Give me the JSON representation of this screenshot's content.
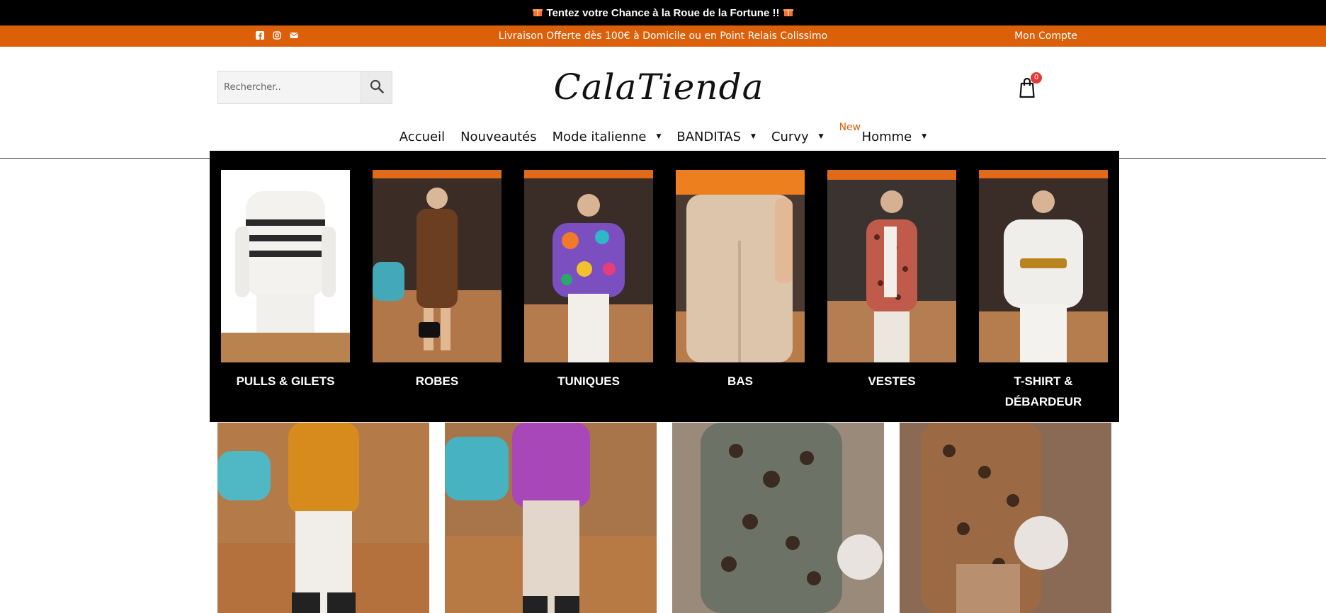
{
  "promo": {
    "text": "Tentez votre Chance à la Roue de la Fortune !!",
    "gift_icon": "gift-icon"
  },
  "infobar": {
    "shipping": "Livraison Offerte dès 100€ à Domicile ou en Point Relais Colissimo",
    "account": "Mon Compte",
    "socials": [
      "facebook-icon",
      "instagram-icon",
      "mail-icon"
    ],
    "accent": "#dc5f0a"
  },
  "search": {
    "placeholder": "Rechercher.."
  },
  "logo": {
    "text": "CalaTienda"
  },
  "cart": {
    "count": "0"
  },
  "nav": {
    "items": [
      {
        "label": "Accueil",
        "has_caret": false
      },
      {
        "label": "Nouveautés",
        "has_caret": false
      },
      {
        "label": "Mode italienne",
        "has_caret": true
      },
      {
        "label": "BANDITAS",
        "has_caret": true
      },
      {
        "label": "Curvy",
        "has_caret": true
      },
      {
        "label": "Homme",
        "has_caret": true,
        "badge": "New"
      }
    ]
  },
  "mega_menu": {
    "categories": [
      {
        "label": "PULLS & GILETS"
      },
      {
        "label": "ROBES"
      },
      {
        "label": "TUNIQUES"
      },
      {
        "label": "BAS"
      },
      {
        "label": "VESTES"
      },
      {
        "label": "T-SHIRT & DÉBARDEUR"
      }
    ]
  }
}
